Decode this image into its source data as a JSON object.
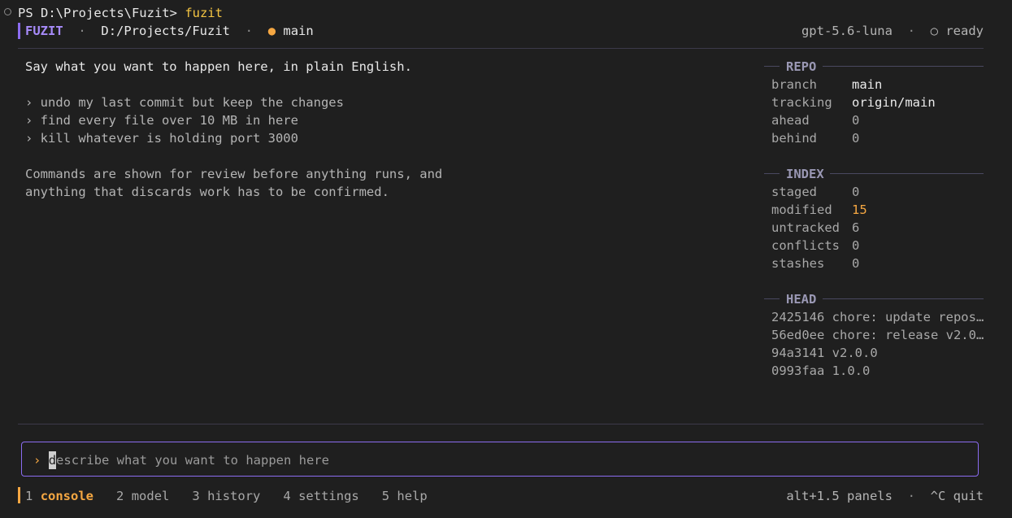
{
  "prompt_line": {
    "path": "PS D:\\Projects\\Fuzit>",
    "command": "fuzit"
  },
  "header": {
    "brand": "FUZIT",
    "separator": "·",
    "path": "D:/Projects/Fuzit",
    "branch_dot": "●",
    "branch": "main",
    "model": "gpt-5.6-luna",
    "status_icon": "○",
    "status": "ready"
  },
  "main": {
    "intro": "Say what you want to happen here, in plain English.",
    "examples": [
      "› undo my last commit but keep the changes",
      "› find every file over 10 MB in here",
      "› kill whatever is holding port 3000"
    ],
    "note_lines": [
      "Commands are shown for review before anything runs, and",
      "anything that discards work has to be confirmed."
    ]
  },
  "sidebar": {
    "repo": {
      "title": "REPO",
      "rows": [
        {
          "label": "branch",
          "value": "main"
        },
        {
          "label": "tracking",
          "value": "origin/main"
        },
        {
          "label": "ahead",
          "value": "0"
        },
        {
          "label": "behind",
          "value": "0"
        }
      ]
    },
    "index": {
      "title": "INDEX",
      "rows": [
        {
          "label": "staged",
          "value": "0"
        },
        {
          "label": "modified",
          "value": "15"
        },
        {
          "label": "untracked",
          "value": "6"
        },
        {
          "label": "conflicts",
          "value": "0"
        },
        {
          "label": "stashes",
          "value": "0"
        }
      ]
    },
    "head": {
      "title": "HEAD",
      "commits": [
        "2425146 chore: update repos…",
        "56ed0ee chore: release v2.0…",
        "94a3141 v2.0.0",
        "0993faa 1.0.0"
      ]
    }
  },
  "input": {
    "chevron": "›",
    "cursor_char": "d",
    "placeholder_rest": "escribe what you want to happen here"
  },
  "footer": {
    "tabs": [
      {
        "num": "1",
        "label": "console"
      },
      {
        "num": "2",
        "label": "model"
      },
      {
        "num": "3",
        "label": "history"
      },
      {
        "num": "4",
        "label": "settings"
      },
      {
        "num": "5",
        "label": "help"
      }
    ],
    "panels_hint": "alt+1.5 panels",
    "separator": "·",
    "quit_hint": "^C quit"
  },
  "colors": {
    "accent": "#8b6cf0",
    "active_tab": "#f5a742",
    "warning_value": "#f5a742",
    "background": "#1f1f1f"
  }
}
